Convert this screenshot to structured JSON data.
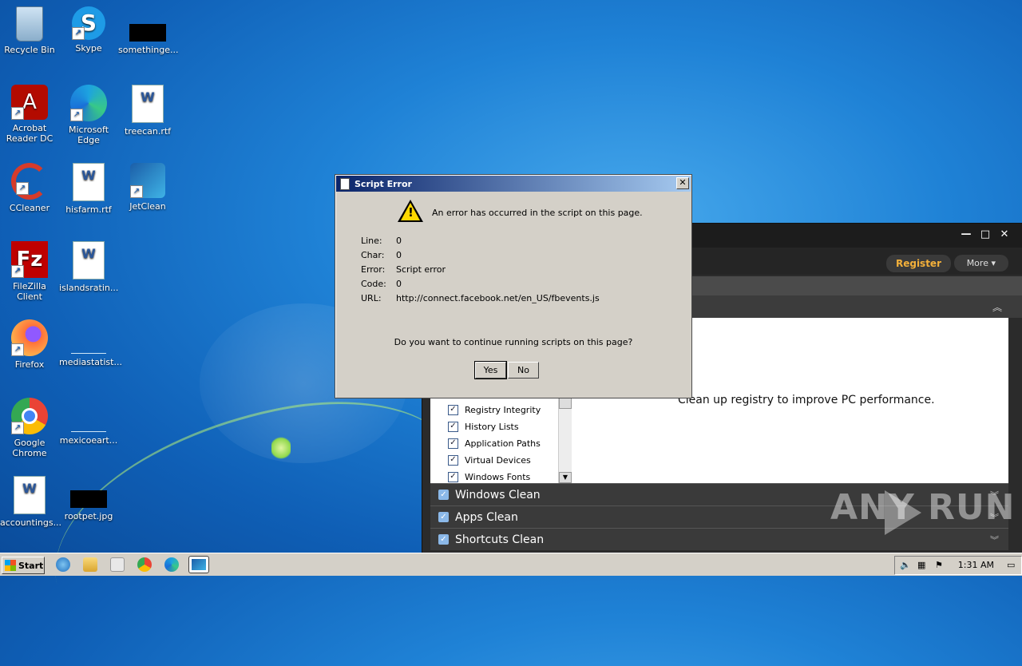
{
  "desktop": {
    "icons": [
      {
        "label": "Recycle Bin",
        "icon": "recycle-bin-icon"
      },
      {
        "label": "Skype",
        "icon": "skype-icon"
      },
      {
        "label": "somethinge...",
        "icon": "black-image-icon"
      },
      {
        "label": "Acrobat Reader DC",
        "icon": "acrobat-icon"
      },
      {
        "label": "Microsoft Edge",
        "icon": "edge-icon"
      },
      {
        "label": "treecan.rtf",
        "icon": "word-doc-icon"
      },
      {
        "label": "CCleaner",
        "icon": "ccleaner-icon"
      },
      {
        "label": "hisfarm.rtf",
        "icon": "word-doc-icon"
      },
      {
        "label": "JetClean",
        "icon": "jetclean-icon"
      },
      {
        "label": "FileZilla Client",
        "icon": "filezilla-icon"
      },
      {
        "label": "islandsratin...",
        "icon": "word-doc-icon"
      },
      {
        "label": "Firefox",
        "icon": "firefox-icon"
      },
      {
        "label": "mediastatist...",
        "icon": "blank-file-icon"
      },
      {
        "label": "Google Chrome",
        "icon": "chrome-icon"
      },
      {
        "label": "mexicoeart...",
        "icon": "blank-file-icon"
      },
      {
        "label": "accountings...",
        "icon": "word-doc-icon"
      },
      {
        "label": "rootpet.jpg",
        "icon": "black-image-icon"
      }
    ]
  },
  "app_window": {
    "register_label": "Register",
    "more_label": "More",
    "description": "Clean up registry to improve PC performance.",
    "checklist": [
      "Registry Integrity",
      "History Lists",
      "Application Paths",
      "Virtual Devices",
      "Windows Fonts"
    ],
    "sections": [
      "Windows Clean",
      "Apps Clean",
      "Shortcuts Clean"
    ]
  },
  "dialog": {
    "title": "Script Error",
    "message": "An error has occurred in the script on this page.",
    "fields": [
      {
        "label": "Line:",
        "value": "0"
      },
      {
        "label": "Char:",
        "value": "0"
      },
      {
        "label": "Error:",
        "value": "Script error"
      },
      {
        "label": "Code:",
        "value": "0"
      },
      {
        "label": "URL:",
        "value": "http://connect.facebook.net/en_US/fbevents.js"
      }
    ],
    "question": "Do you want to continue running scripts on this page?",
    "yes_label": "Yes",
    "no_label": "No"
  },
  "taskbar": {
    "start_label": "Start",
    "clock": "1:31 AM"
  },
  "watermark": "ANY RUN"
}
